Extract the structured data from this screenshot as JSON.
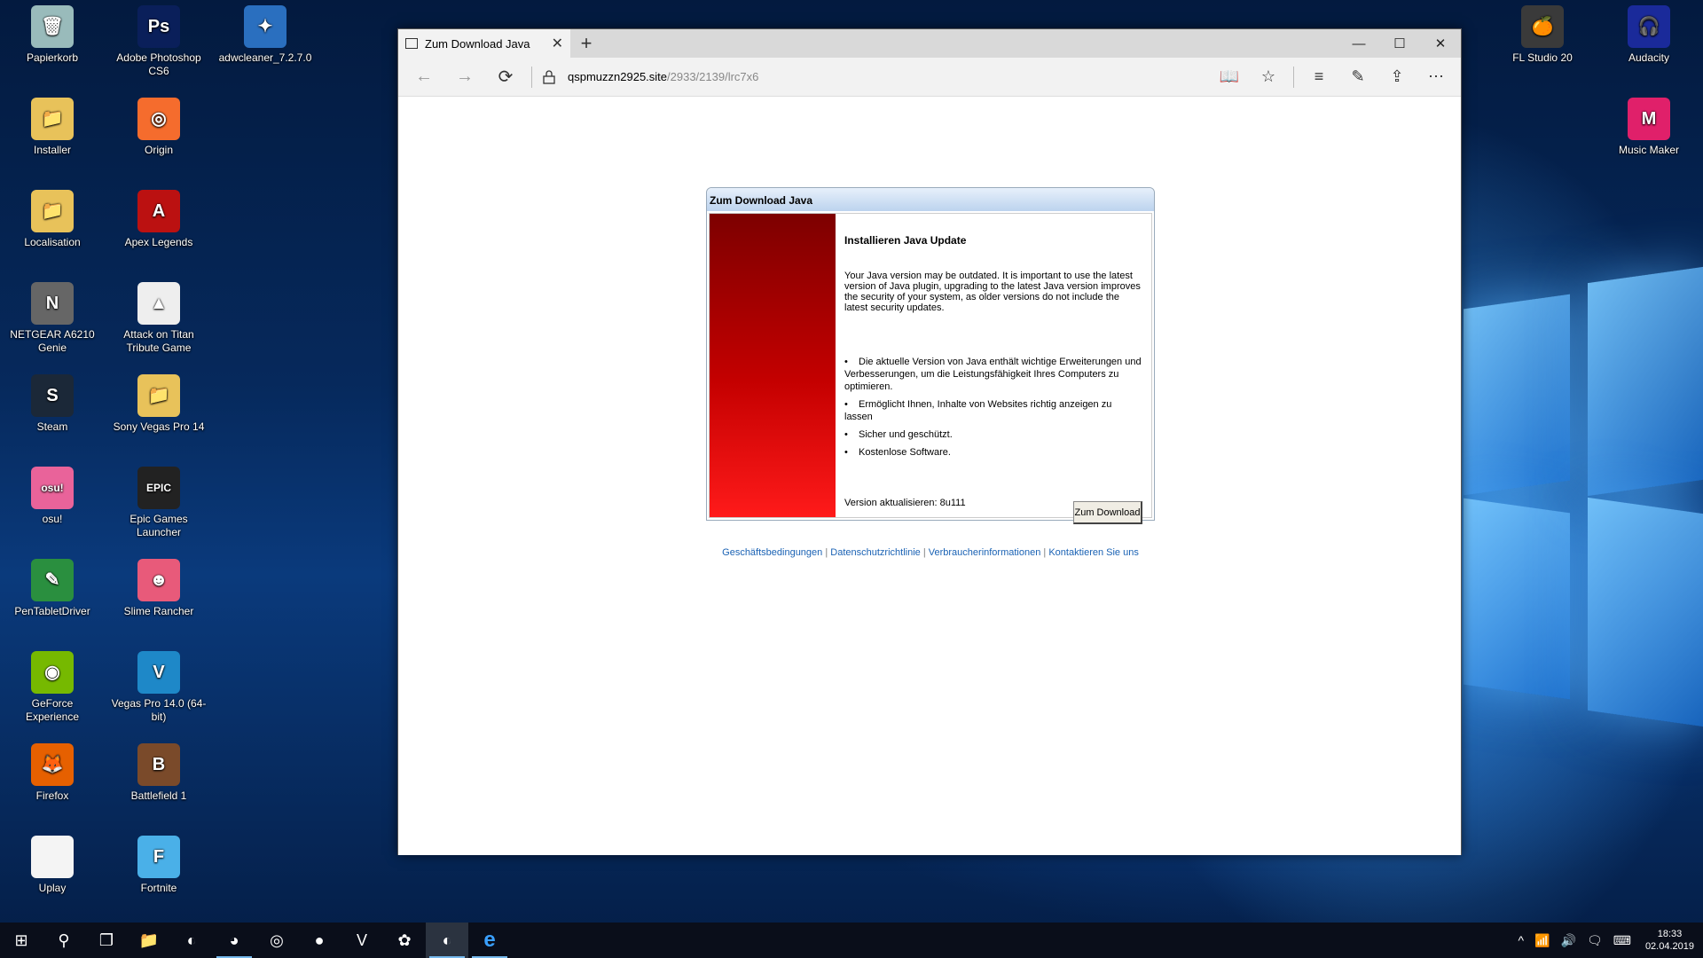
{
  "desktop": {
    "icons_left": [
      {
        "label": "Papierkorb",
        "glyph": "🗑",
        "color": "#9bb"
      },
      {
        "label": "Installer",
        "glyph": "📁",
        "color": "#e8c25a"
      },
      {
        "label": "Localisation",
        "glyph": "📁",
        "color": "#e8c25a"
      },
      {
        "label": "NETGEAR A6210 Genie",
        "glyph": "N",
        "color": "#666"
      },
      {
        "label": "Steam",
        "glyph": "S",
        "color": "#1b2838"
      },
      {
        "label": "osu!",
        "glyph": "osu!",
        "color": "#e9639a"
      },
      {
        "label": "PenTabletDriver",
        "glyph": "✎",
        "color": "#2a8f3f"
      },
      {
        "label": "GeForce Experience",
        "glyph": "◉",
        "color": "#76b900"
      },
      {
        "label": "Firefox",
        "glyph": "🦊",
        "color": "#e66000"
      },
      {
        "label": "Uplay",
        "glyph": "",
        "color": "#f4f4f4"
      }
    ],
    "icons_mid": [
      {
        "label": "Adobe Photoshop CS6",
        "glyph": "Ps",
        "color": "#0a1f5a"
      },
      {
        "label": "Origin",
        "glyph": "◎",
        "color": "#f56c2d"
      },
      {
        "label": "Apex Legends",
        "glyph": "A",
        "color": "#b11"
      },
      {
        "label": "Attack on Titan Tribute Game",
        "glyph": "▲",
        "color": "#eee"
      },
      {
        "label": "Sony Vegas Pro 14",
        "glyph": "📁",
        "color": "#e8c25a"
      },
      {
        "label": "Epic Games Launcher",
        "glyph": "EPIC",
        "color": "#222"
      },
      {
        "label": "Slime Rancher",
        "glyph": "☻",
        "color": "#e85a7a"
      },
      {
        "label": "Vegas Pro 14.0 (64-bit)",
        "glyph": "V",
        "color": "#1e88c8"
      },
      {
        "label": "Battlefield 1",
        "glyph": "B",
        "color": "#7a4a2a"
      },
      {
        "label": "Fortnite",
        "glyph": "F",
        "color": "#4ab0e8"
      }
    ],
    "icons_extra": [
      {
        "label": "adwcleaner_7.2.7.0",
        "glyph": "✦",
        "color": "#2a6fbf"
      }
    ],
    "icons_right": [
      {
        "label": "FL Studio 20",
        "glyph": "🍊",
        "color": "#3a3a3a"
      },
      {
        "label": "Audacity",
        "glyph": "🎧",
        "color": "#1a2a9a"
      },
      {
        "label": "Music Maker",
        "glyph": "M",
        "color": "#e0206a"
      }
    ]
  },
  "browser": {
    "tab_title": "Zum Download Java",
    "tab_close": "✕",
    "new_tab": "+",
    "url_host": "qspmuzzn2925.site",
    "url_path": "/2933/2139/lrc7x6",
    "controls": {
      "minimize": "—",
      "maximize": "☐",
      "close": "✕"
    },
    "nav": {
      "back": "←",
      "forward": "→",
      "refresh": "⟳"
    },
    "toolbar": {
      "reading": "📖",
      "favorite": "☆",
      "hub": "≡",
      "notes": "✎",
      "share": "⇪",
      "more": "⋯"
    }
  },
  "dialog": {
    "title": "Zum Download Java",
    "heading": "Installieren Java Update",
    "intro": "Your Java version may be outdated. It is important to use the latest version of Java plugin, upgrading to the latest Java version improves the security of your system, as older versions do not include the latest security updates.",
    "bullets": [
      "Die aktuelle Version von Java enthält wichtige Erweiterungen und Verbesserungen, um die Leistungsfähigkeit Ihres Computers zu optimieren.",
      "Ermöglicht Ihnen, Inhalte von Websites richtig anzeigen zu lassen",
      "Sicher und geschützt.",
      "Kostenlose Software."
    ],
    "bullet_char": "•",
    "version": "Version aktualisieren: 8u111",
    "download_button": "Zum Download"
  },
  "footer": {
    "links": [
      "Geschäftsbedingungen",
      "Datenschutzrichtlinie",
      "Verbraucherinformationen",
      "Kontaktieren Sie uns"
    ],
    "separator": "|"
  },
  "taskbar": {
    "items": [
      {
        "name": "start-button",
        "glyph": "⊞"
      },
      {
        "name": "search-icon",
        "glyph": "⚲"
      },
      {
        "name": "task-view-icon",
        "glyph": "❐"
      },
      {
        "name": "file-explorer-icon",
        "glyph": "📁"
      },
      {
        "name": "steam-taskbar-icon",
        "glyph": "◐"
      },
      {
        "name": "firefox-taskbar-icon",
        "glyph": "◕"
      },
      {
        "name": "origin-taskbar-icon",
        "glyph": "◎"
      },
      {
        "name": "osu-taskbar-icon",
        "glyph": "●"
      },
      {
        "name": "vegas-taskbar-icon",
        "glyph": "V"
      },
      {
        "name": "app-taskbar-icon",
        "glyph": "✿"
      },
      {
        "name": "steam-running-icon",
        "glyph": "◐"
      },
      {
        "name": "edge-taskbar-icon",
        "glyph": "e"
      }
    ],
    "tray": {
      "chevron": "^",
      "network": "📶",
      "volume": "🔊",
      "notifications": "🗨",
      "keyboard": "⌨"
    },
    "time": "18:33",
    "date": "02.04.2019"
  }
}
